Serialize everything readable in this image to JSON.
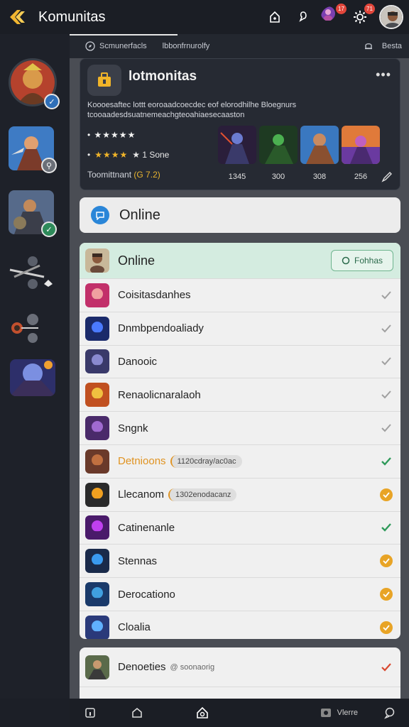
{
  "app": {
    "title": "Komunitas"
  },
  "topbar": {
    "badges": [
      "17",
      "71"
    ]
  },
  "subtabs": {
    "tab1": "Scmunerfacls",
    "tab2": "lbbonfrnurolfy",
    "right_label": "Besta"
  },
  "community": {
    "title": "lotmonitas",
    "more": "•••",
    "description": "Koooesaftec lottt eoroaadcoecdec eof elorodhilhe Bloegnurs tcooaadesdsuatnemeachgteoahiaesecaaston",
    "rating_row1": "• ★★★★★",
    "rating_row2_prefix": "•",
    "rating_row2_stars": "★★★★",
    "rating_row2_suffix": "★ 1 Sone",
    "footer_label": "Toomittnant",
    "footer_value": "(G 7.2)",
    "game_counts": [
      "1345",
      "300",
      "308",
      "256"
    ]
  },
  "online_card": {
    "label": "Online"
  },
  "online_list": {
    "header_title": "Online",
    "follow_label": "Fohhas",
    "rows": [
      {
        "name": "Coisitasdanhes",
        "status": "gray-check"
      },
      {
        "name": "Dnmbpendoaliady",
        "status": "gray-check"
      },
      {
        "name": "Danooic",
        "status": "gray-check"
      },
      {
        "name": "Renaolicnaralaoh",
        "status": "gray-check"
      },
      {
        "name": "Sngnk",
        "status": "gray-check"
      },
      {
        "name": "Detnioons",
        "tag": "1120cdray/ac0ac",
        "status": "green-check",
        "highlight": true
      },
      {
        "name": "Llecanom",
        "tag": "1302enodacanz",
        "status": "orange-check"
      },
      {
        "name": "Catinenanle",
        "status": "green-check"
      },
      {
        "name": "Stennas",
        "status": "orange-check"
      },
      {
        "name": "Derocationo",
        "status": "orange-check"
      },
      {
        "name": "Cloalia",
        "status": "orange-check"
      }
    ]
  },
  "extra_row": {
    "name": "Denoeties",
    "sub": "@ soonaorig",
    "status": "red-check"
  },
  "bottombar": {
    "view_label": "Vlerre"
  },
  "colors": {
    "accent": "#f0b429",
    "check_green": "#2f9a5a",
    "check_orange": "#e8a426",
    "check_gray": "#a0a0a0",
    "check_red": "#d9482f"
  }
}
